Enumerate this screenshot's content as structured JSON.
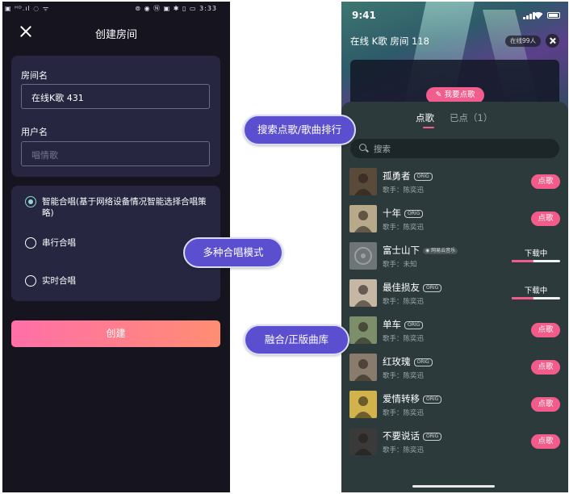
{
  "left": {
    "status_left": "▣ ᴴᴰ.ıl ◌ ᯤ",
    "status_right": "⊚ ◉ Ⓝ ▣ ✱ ▯ ▭ 3:33",
    "title": "创建房间",
    "room_name_label": "房间名",
    "room_name_value": "在线K歌 431",
    "user_name_label": "用户名",
    "user_name_placeholder": "唱情歌",
    "options": [
      {
        "label": "智能合唱(基于网络设备情况智能选择合唱策略)",
        "selected": true
      },
      {
        "label": "串行合唱",
        "selected": false
      },
      {
        "label": "实时合唱",
        "selected": false
      }
    ],
    "create_button": "创建"
  },
  "right": {
    "time": "9:41",
    "room_title": "在线 K歌 房间 118",
    "online_count": "在线99人",
    "order_button": "✎ 我要点歌",
    "tabs": {
      "active": "点歌",
      "inactive": "已点（1）"
    },
    "search_placeholder": "搜索",
    "sing_label": "点歌",
    "downloading_label": "下载中",
    "songs": [
      {
        "title": "孤勇者",
        "tag": "ORIG",
        "singer": "歌手：陈奕迅",
        "action": "sing"
      },
      {
        "title": "十年",
        "tag": "ORIG",
        "singer": "歌手：陈奕迅",
        "action": "sing"
      },
      {
        "title": "富士山下",
        "tag": "◉ 网易云音乐",
        "singer": "歌手：未知",
        "action": "download",
        "progress": 0.45
      },
      {
        "title": "最佳损友",
        "tag": "ORIG",
        "singer": "歌手：陈奕迅",
        "action": "download",
        "progress": 0.45
      },
      {
        "title": "单车",
        "tag": "ORIG",
        "singer": "歌手：陈奕迅",
        "action": "sing"
      },
      {
        "title": "红玫瑰",
        "tag": "ORIG",
        "singer": "歌手：陈奕迅",
        "action": "sing"
      },
      {
        "title": "爱情转移",
        "tag": "ORIG",
        "singer": "歌手：陈奕迅",
        "action": "sing"
      },
      {
        "title": "不要说话",
        "tag": "ORIG",
        "singer": "歌手：陈奕迅",
        "action": "sing"
      }
    ]
  },
  "callouts": [
    "搜索点歌/歌曲排行",
    "多种合唱模式",
    "融合/正版曲库"
  ],
  "colors": {
    "accent_pink": "#f25b8a",
    "callout_purple": "#5b4fd0",
    "left_bg": "#15141f"
  }
}
